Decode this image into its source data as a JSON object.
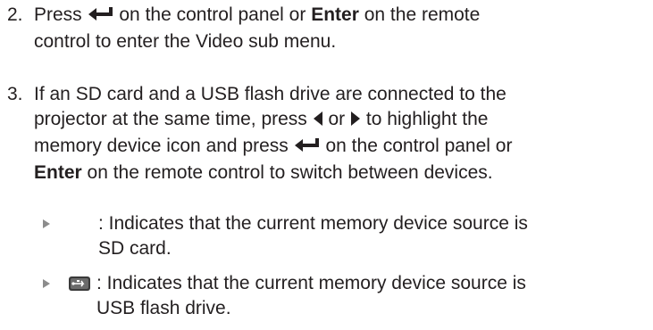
{
  "steps": [
    {
      "number": "2.",
      "part1": "Press",
      "enter_icon": "enter-return-icon",
      "part2": "on the control panel or",
      "bold_word": "Enter",
      "part3": "on the remote",
      "line2": "control to enter the Video sub menu."
    },
    {
      "number": "3.",
      "line1": "If an SD card and a USB flash drive are connected to the",
      "line2_a": "projector at the same time, press",
      "left_icon": "left-triangle-icon",
      "or_word": "or",
      "right_icon": "right-triangle-icon",
      "line2_b": "to highlight the",
      "line3_a": "memory device icon and press",
      "enter_icon": "enter-return-icon",
      "line3_b": "on the control panel or",
      "line4_bold": "Enter",
      "line4_rest": "on the remote control to switch between devices."
    }
  ],
  "bullets": [
    {
      "icon": "sd-card-icon",
      "line1": ": Indicates that the current memory device source is",
      "line2": "SD card."
    },
    {
      "icon": "usb-drive-icon",
      "line1": ": Indicates that the current memory device source is",
      "line2": "USB flash drive."
    }
  ],
  "colors": {
    "text": "#231f20",
    "bullet_arrow": "#8c8c8c"
  }
}
